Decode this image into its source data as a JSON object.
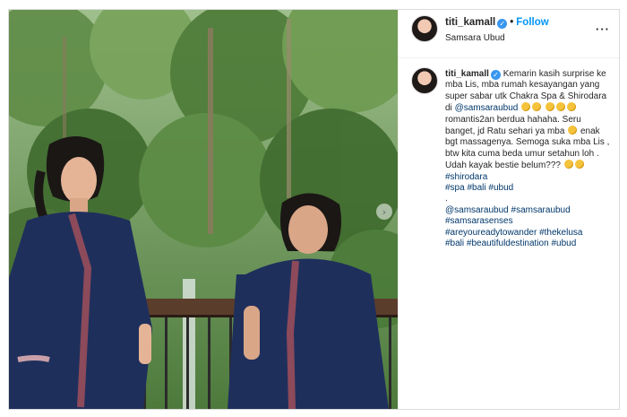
{
  "post": {
    "username": "titi_kamall",
    "follow_label": "Follow",
    "location": "Samsara Ubud",
    "more_label": "···",
    "carousel_next_icon": "chevron-right-icon",
    "caption": {
      "username": "titi_kamall",
      "text_1": "Kemarin kasih surprise ke mba Lis, mba rumah kesayangan yang super sabar utk Chakra Spa & Shirodara di",
      "mention_1": "@samsaraubud",
      "text_2": "romantis2an berdua hahaha. Seru banget, jd Ratu sehari ya mba",
      "text_3": "enak bgt massagenya. Semoga suka mba Lis , btw kita cuma beda umur setahun loh . Udah kayak bestie belum???",
      "hashtag_shirodara": "#shirodara",
      "hashtag_spa": "#spa",
      "hashtag_bali_1": "#bali",
      "hashtag_ubud_1": "#ubud",
      "dot_line": ".",
      "mention_2": "@samsaraubud",
      "hashtag_samsaraubud": "#samsaraubud",
      "hashtag_samsarasenses": "#samsarasenses",
      "hashtag_areyoureadytowander": "#areyoureadytowander",
      "hashtag_thekelusa": "#thekelusa",
      "hashtag_bali_2": "#bali",
      "hashtag_beautifuldestination": "#beautifuldestination",
      "hashtag_ubud_2": "#ubud"
    }
  },
  "colors": {
    "link": "#00376b",
    "follow": "#0095f6",
    "verified": "#3897f0",
    "robe": "#1f2f5c"
  }
}
